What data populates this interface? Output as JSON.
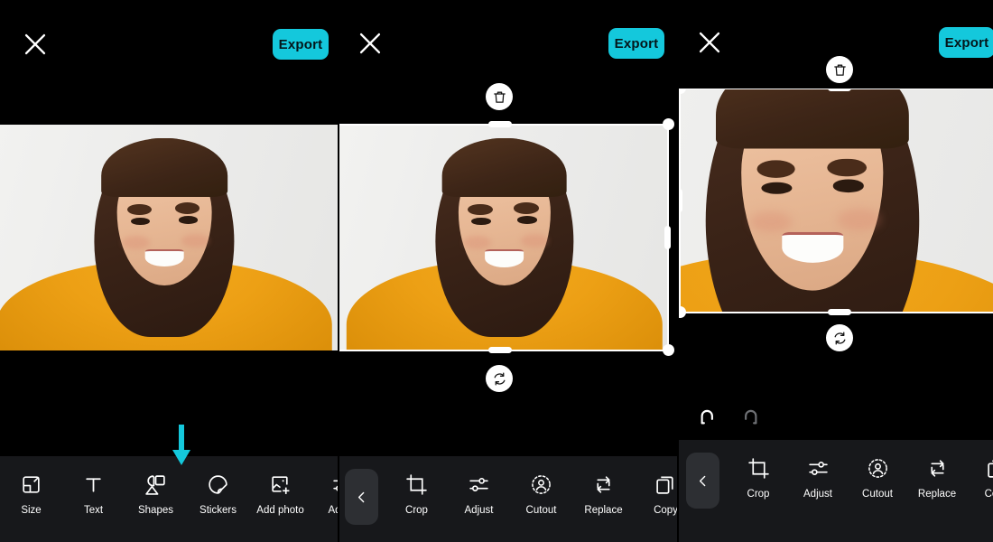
{
  "app": {
    "accent_color": "#14c8dc",
    "toolbar_color": "#17181b",
    "canvas_color": "#000000"
  },
  "panels": [
    {
      "id": "panel-1",
      "close_label": "Close",
      "export_label": "Export",
      "toolbar": {
        "items": [
          {
            "label": "Size",
            "icon": "size-icon"
          },
          {
            "label": "Text",
            "icon": "text-icon"
          },
          {
            "label": "Shapes",
            "icon": "shapes-icon"
          },
          {
            "label": "Stickers",
            "icon": "stickers-icon"
          },
          {
            "label": "Add photo",
            "icon": "add-photo-icon"
          },
          {
            "label": "Adjust",
            "icon": "adjust-icon"
          }
        ]
      },
      "annotation": {
        "type": "down-arrow",
        "color": "#14c8dc",
        "points_at": "Shapes"
      }
    },
    {
      "id": "panel-2",
      "close_label": "Close",
      "export_label": "Export",
      "back_label": "Back",
      "selection": {
        "delete_label": "Delete",
        "rotate_label": "Rotate"
      },
      "toolbar": {
        "items": [
          {
            "label": "Crop",
            "icon": "crop-icon"
          },
          {
            "label": "Adjust",
            "icon": "adjust-icon"
          },
          {
            "label": "Cutout",
            "icon": "cutout-icon"
          },
          {
            "label": "Replace",
            "icon": "replace-icon"
          },
          {
            "label": "Copy",
            "icon": "copy-icon"
          }
        ]
      },
      "annotation": {
        "type": "down-arrow",
        "color": "#14c8dc",
        "points_at": "Cutout"
      }
    },
    {
      "id": "panel-3",
      "close_label": "Close",
      "export_label": "Export",
      "back_label": "Back",
      "selection": {
        "delete_label": "Delete",
        "rotate_label": "Rotate"
      },
      "history": {
        "undo_label": "Undo",
        "undo_enabled": "true",
        "redo_label": "Redo",
        "redo_enabled": "false"
      },
      "toolbar": {
        "items": [
          {
            "label": "Crop",
            "icon": "crop-icon"
          },
          {
            "label": "Adjust",
            "icon": "adjust-icon"
          },
          {
            "label": "Cutout",
            "icon": "cutout-icon"
          },
          {
            "label": "Replace",
            "icon": "replace-icon"
          },
          {
            "label": "Copy",
            "icon": "copy-icon"
          }
        ]
      }
    }
  ]
}
